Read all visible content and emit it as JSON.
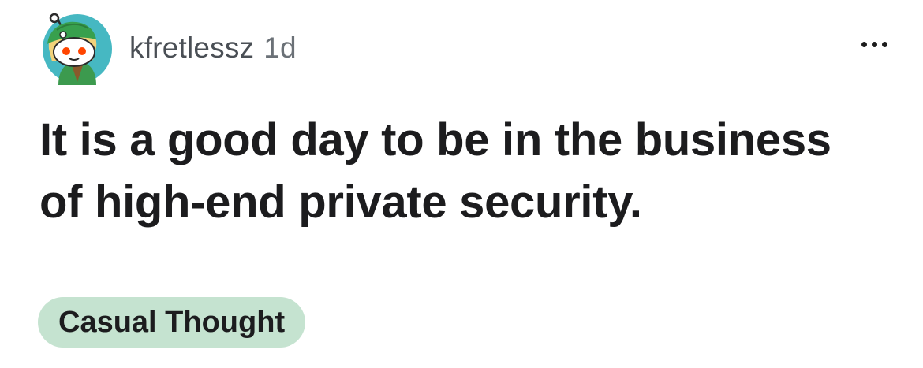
{
  "post": {
    "author": "kfretlessz",
    "age": "1d",
    "title": "It is a good day to be in the business of high-end private security.",
    "flair": "Casual Thought",
    "flair_color": "#c5e3d0"
  },
  "icons": {
    "avatar": "reddit-snoo-avatar",
    "more": "more-options-icon"
  }
}
